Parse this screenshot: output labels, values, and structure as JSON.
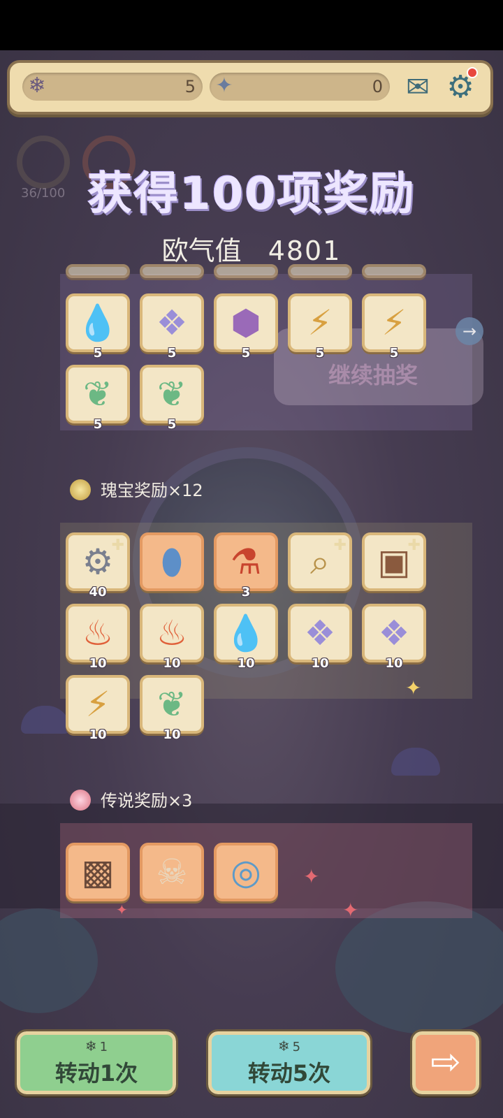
{
  "colors": {
    "background": "#463c51",
    "card": "#f3e6c6",
    "card_highlight": "#f4b98a",
    "button_1": "#8fcf8f",
    "button_5": "#8ad6d6",
    "button_next": "#f0a47a"
  },
  "resources": {
    "ticket": {
      "icon": "ticket-icon",
      "value": "5"
    },
    "crystal": {
      "icon": "crystal-icon",
      "value": "0"
    }
  },
  "icons": {
    "mail": "mail-icon",
    "settings": "gear-icon"
  },
  "progress": {
    "text": "36/100"
  },
  "header": {
    "title": "获得100项奖励",
    "luck_label": "欧气值",
    "luck_value": "4801"
  },
  "continue": {
    "label": "继续抽奖"
  },
  "common_rewards": [
    {
      "icon": "water-drop-icon",
      "count": "5"
    },
    {
      "icon": "crystal-shard-icon",
      "count": "5"
    },
    {
      "icon": "purple-rune-cube-icon",
      "count": "5"
    },
    {
      "icon": "lightning-feather-icon",
      "count": "5"
    },
    {
      "icon": "lightning-feather-icon",
      "count": "5"
    },
    {
      "icon": "green-leaf-heart-icon",
      "count": "5"
    },
    {
      "icon": "green-leaf-heart-icon",
      "count": "5"
    }
  ],
  "treasure_section": {
    "title": "瑰宝奖励×12",
    "items": [
      {
        "icon": "machine-parts-icon",
        "count": "40"
      },
      {
        "icon": "blue-crystal-egg-icon",
        "count": ""
      },
      {
        "icon": "potion-bottle-icon",
        "count": "3"
      },
      {
        "icon": "telescope-icon",
        "count": ""
      },
      {
        "icon": "painting-icon",
        "count": ""
      },
      {
        "icon": "fire-essence-icon",
        "count": "10"
      },
      {
        "icon": "fire-essence-icon",
        "count": "10"
      },
      {
        "icon": "water-drop-icon",
        "count": "10"
      },
      {
        "icon": "crystal-shard-icon",
        "count": "10"
      },
      {
        "icon": "crystal-shard-icon",
        "count": "10"
      },
      {
        "icon": "lightning-feather-icon",
        "count": "10"
      },
      {
        "icon": "green-leaf-heart-icon",
        "count": "10"
      }
    ]
  },
  "legend_section": {
    "title": "传说奖励×3",
    "items": [
      {
        "icon": "framed-painting-icon",
        "count": ""
      },
      {
        "icon": "flaming-skull-icon",
        "count": ""
      },
      {
        "icon": "blue-dragon-orb-icon",
        "count": ""
      }
    ]
  },
  "buttons": {
    "spin_once": {
      "cost": "1",
      "label": "转动1次"
    },
    "spin_five": {
      "cost": "5",
      "label": "转动5次"
    }
  }
}
